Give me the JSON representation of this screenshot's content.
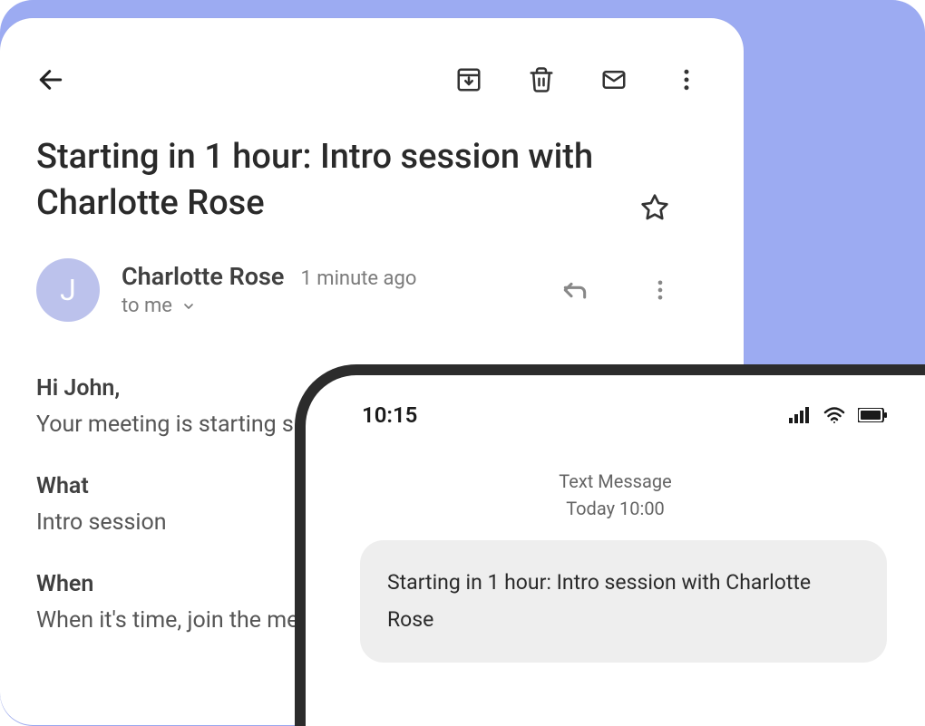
{
  "email": {
    "subject": "Starting in 1 hour: Intro session with Charlotte Rose",
    "sender": {
      "name": "Charlotte Rose",
      "initial": "J",
      "time": "1 minute ago",
      "recipient": "to me"
    },
    "body": {
      "greeting": "Hi John,",
      "line1": "Your meeting is starting soon.",
      "what_label": "What",
      "what_value": "Intro session",
      "when_label": "When",
      "when_value": "When it's time, join the meeting from your calendar."
    }
  },
  "phone": {
    "clock": "10:15",
    "sms_type": "Text Message",
    "sms_time": "Today 10:00",
    "sms_body": "Starting in 1 hour: Intro session with Charlotte Rose"
  }
}
